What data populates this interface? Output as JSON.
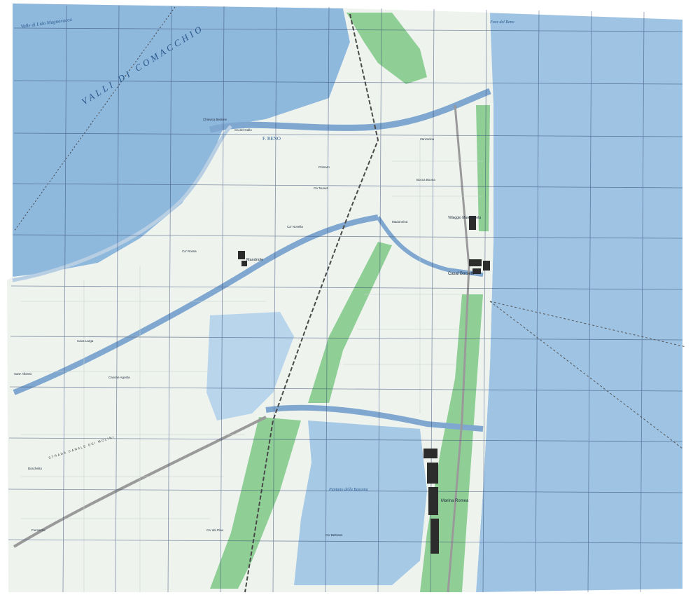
{
  "map": {
    "water_labels": {
      "lagoon_name": "VALLI DI COMACCHIO",
      "lagoon_edge": "Valle di Lido Magnavacca",
      "river": "F. RENO",
      "river_mouth": "Foce del Reno",
      "south_lagoon": "Pantano della Bassona"
    },
    "towns": {
      "casal_borsetti": "Casal Borsetti",
      "marina_romea": "Marina Romea",
      "mandriole": "Mandriole",
      "villaggio": "Villaggio Mare Pineta"
    },
    "places": [
      "Chiavica Bedone",
      "Ca del Gallo",
      "Casone Agosta",
      "Ca' Nuova",
      "Zanzarina",
      "Bocca Buona",
      "Ca' Rossa",
      "Ca' Novella",
      "Madonnina",
      "Boschetto",
      "Ca' del Pino",
      "Ca' Beltrami",
      "Primaro",
      "Cava Larga",
      "Fiumazzo",
      "Sant' Alberto"
    ],
    "roads": {
      "strada_canale": "STRADA CANALE DEI MOLINI"
    },
    "colors": {
      "sea": "#9ec3e3",
      "lagoon": "#8fb8dd",
      "land": "#eef3ee",
      "pine_forest": "#8fcf96",
      "grid": "#2a3f6b",
      "road": "#f2f2f2",
      "canal": "#7fa7cf",
      "settlement": "#2c2c2c"
    }
  }
}
